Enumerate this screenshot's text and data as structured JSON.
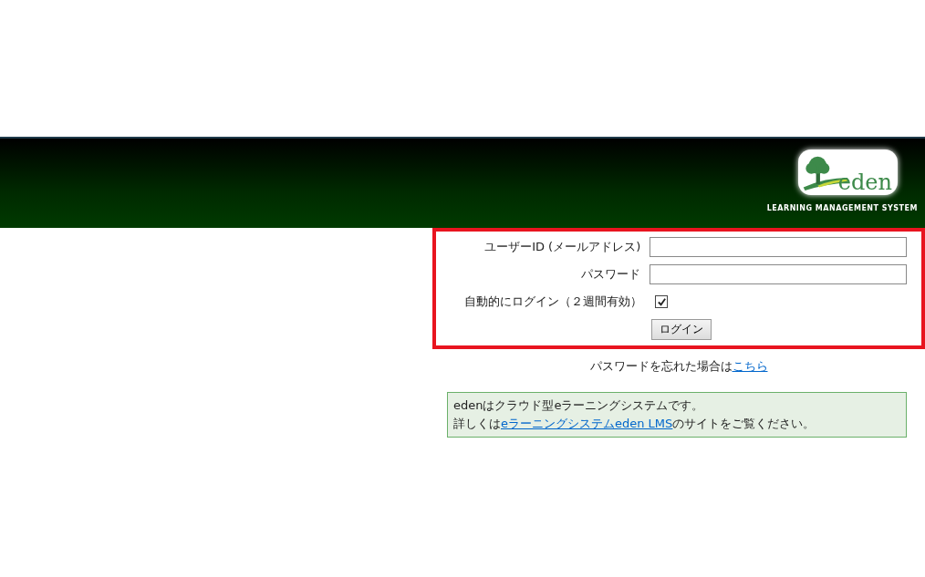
{
  "banner": {
    "logo_word": "eden",
    "tagline": "LEARNING MANAGEMENT SYSTEM"
  },
  "login_form": {
    "fields": [
      {
        "label": "ユーザーID (メールアドレス)"
      },
      {
        "label": "パスワード"
      }
    ],
    "auto_login": {
      "label": "自動的にログイン（２週間有効）",
      "checked": true
    },
    "submit": "ログイン"
  },
  "forgot": {
    "text": "パスワードを忘れた場合は",
    "link": "こちら"
  },
  "info": {
    "line1": "edenはクラウド型eラーニングシステムです。",
    "line2_before": "詳しくは",
    "line2_link": "eラーニングシステムeden LMS",
    "line2_after": "のサイトをご覧ください。"
  }
}
